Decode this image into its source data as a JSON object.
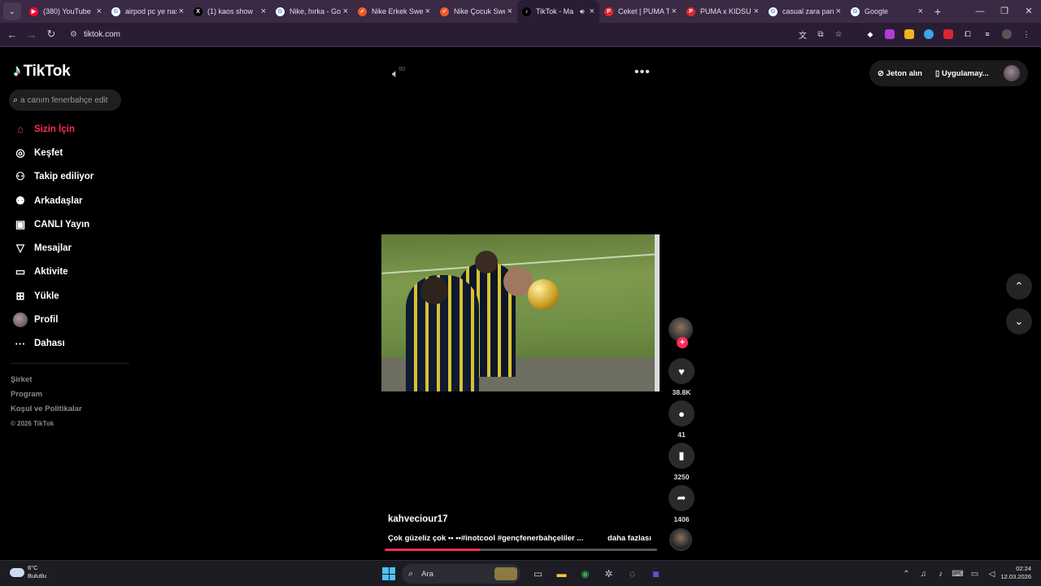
{
  "browser": {
    "tabs": [
      {
        "title": "(380) YouTube",
        "favicon": "youtube-icon",
        "color": "#ff0033",
        "glyph": "▶"
      },
      {
        "title": "airpod pc ye nasıl",
        "favicon": "google-icon",
        "color": "#ffffff",
        "glyph": "G"
      },
      {
        "title": "(1) kaos show",
        "favicon": "x-icon",
        "color": "#000000",
        "glyph": "X"
      },
      {
        "title": "Nike, hırka - Goo",
        "favicon": "google-icon",
        "color": "#ffffff",
        "glyph": "G"
      },
      {
        "title": "Nike Erkek Swea",
        "favicon": "nike-icon",
        "color": "#f05a28",
        "glyph": "✓"
      },
      {
        "title": "Nike Çocuk Swea",
        "favicon": "nike-icon",
        "color": "#f05a28",
        "glyph": "✓"
      },
      {
        "title": "TikTok - Ma",
        "favicon": "tiktok-icon",
        "color": "#000000",
        "glyph": "♪",
        "active": true,
        "audio": true
      },
      {
        "title": "Ceket | PUMA Tü",
        "favicon": "puma-icon",
        "color": "#e3262f",
        "glyph": "P"
      },
      {
        "title": "PUMA x KIDSUPE",
        "favicon": "puma-icon",
        "color": "#e3262f",
        "glyph": "P"
      },
      {
        "title": "casual zara pantol",
        "favicon": "google-icon",
        "color": "#ffffff",
        "glyph": "G"
      },
      {
        "title": "Google",
        "favicon": "google-icon",
        "color": "#ffffff",
        "glyph": "G"
      }
    ],
    "url": "tiktok.com"
  },
  "sidebar": {
    "logo_text": "TikTok",
    "search_placeholder": "a canım fenerbahçe edit",
    "items": [
      {
        "label": "Sizin İçin",
        "icon": "home-icon",
        "glyph": "⌂",
        "active": true
      },
      {
        "label": "Keşfet",
        "icon": "compass-icon",
        "glyph": "◎"
      },
      {
        "label": "Takip ediliyor",
        "icon": "user-follow-icon",
        "glyph": "⚇"
      },
      {
        "label": "Arkadaşlar",
        "icon": "friends-icon",
        "glyph": "⚉"
      },
      {
        "label": "CANLI Yayın",
        "icon": "live-icon",
        "glyph": "▣"
      },
      {
        "label": "Mesajlar",
        "icon": "send-icon",
        "glyph": "▽"
      },
      {
        "label": "Aktivite",
        "icon": "activity-icon",
        "glyph": "▭"
      },
      {
        "label": "Yükle",
        "icon": "upload-icon",
        "glyph": "⊞"
      },
      {
        "label": "Profil",
        "icon": "profile-avatar",
        "glyph": ""
      },
      {
        "label": "Dahası",
        "icon": "more-icon",
        "glyph": "···"
      }
    ],
    "footer": [
      "Şirket",
      "Program",
      "Koşul ve Politikalar"
    ],
    "copyright": "© 2026 TikTok"
  },
  "header": {
    "coins_label": "Jeton alın",
    "app_label": "Uygulamay..."
  },
  "video": {
    "author": "kahveciour17",
    "caption": "Çok güzeliz çok •• ••#inotcool #gençfenerbahçeliler ...",
    "more_label": "daha fazlası",
    "progress": 0.35,
    "volume_indicator": "00"
  },
  "actions": {
    "likes": "38.8K",
    "comments": "41",
    "saves": "3250",
    "shares": "1406"
  },
  "taskbar": {
    "temperature": "6°C",
    "weather": "Bulutlu",
    "search_label": "Ara",
    "time": "02:24",
    "date": "12.03.2026"
  }
}
